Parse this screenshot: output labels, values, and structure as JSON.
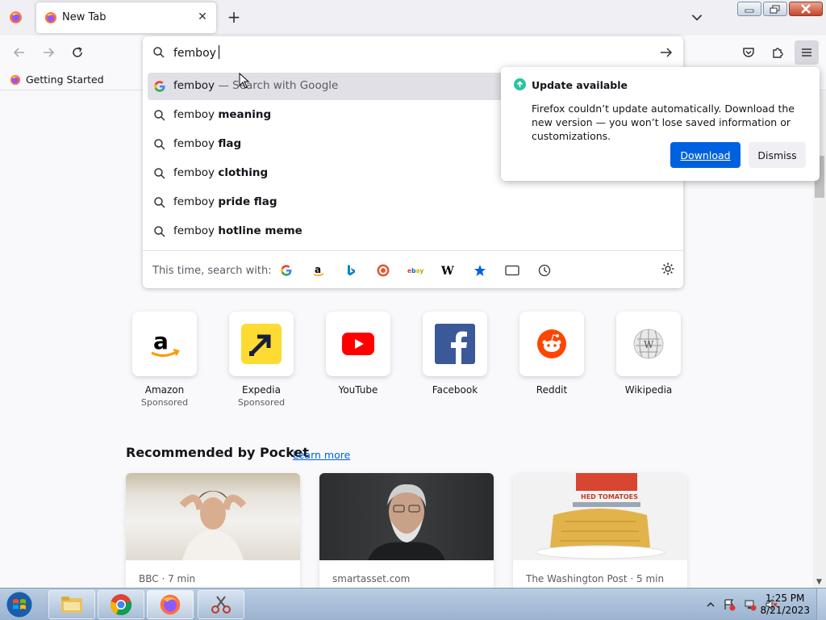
{
  "tab": {
    "title": "New Tab",
    "close": "✕",
    "new": "+"
  },
  "urlbar": {
    "value": "femboy",
    "suggestions": [
      {
        "prefix": "femboy",
        "bold": "",
        "action": "— Search with Google",
        "selected": true,
        "icon": "google-g-icon"
      },
      {
        "prefix": "femboy ",
        "bold": "meaning",
        "icon": "search-icon"
      },
      {
        "prefix": "femboy ",
        "bold": "flag",
        "icon": "search-icon"
      },
      {
        "prefix": "femboy ",
        "bold": "clothing",
        "icon": "search-icon"
      },
      {
        "prefix": "femboy ",
        "bold": "pride flag",
        "icon": "search-icon"
      },
      {
        "prefix": "femboy ",
        "bold": "hotline meme",
        "icon": "search-icon"
      }
    ],
    "oneoff_label": "This time, search with:",
    "engines": [
      {
        "name": "google",
        "glyph": "G",
        "color": "#4285f4"
      },
      {
        "name": "amazon",
        "glyph": "a",
        "color": "#000000"
      },
      {
        "name": "bing",
        "glyph": "b",
        "color": "#0078d4"
      },
      {
        "name": "duckduckgo",
        "glyph": "",
        "color": "#de5833"
      },
      {
        "name": "ebay",
        "glyph": "ebay",
        "color": "#e53238"
      },
      {
        "name": "wikipedia",
        "glyph": "W",
        "color": "#000000"
      },
      {
        "name": "bookmarks",
        "glyph": "★",
        "color": "#0061e0"
      },
      {
        "name": "tabs",
        "glyph": "",
        "color": "#15141a"
      },
      {
        "name": "history",
        "glyph": "",
        "color": "#15141a"
      }
    ]
  },
  "bookmarks": {
    "getting_started": "Getting Started"
  },
  "notification": {
    "title": "Update available",
    "message": "Firefox couldn’t update automatically. Download the new version — you won’t lose saved information or customizations.",
    "download": "Download",
    "dismiss": "Dismiss"
  },
  "top_sites": [
    {
      "name": "Amazon",
      "sponsored": "Sponsored"
    },
    {
      "name": "Expedia",
      "sponsored": "Sponsored"
    },
    {
      "name": "YouTube",
      "sponsored": ""
    },
    {
      "name": "Facebook",
      "sponsored": ""
    },
    {
      "name": "Reddit",
      "sponsored": ""
    },
    {
      "name": "Wikipedia",
      "sponsored": ""
    }
  ],
  "pocket": {
    "title": "Recommended by Pocket",
    "learn_more": "Learn more",
    "cards": [
      {
        "source": "BBC · 7 min"
      },
      {
        "source": "smartasset.com"
      },
      {
        "source": "The Washington Post · 5 min"
      }
    ]
  },
  "taskbar": {
    "time": "1:25 PM",
    "date": "8/21/2023"
  }
}
